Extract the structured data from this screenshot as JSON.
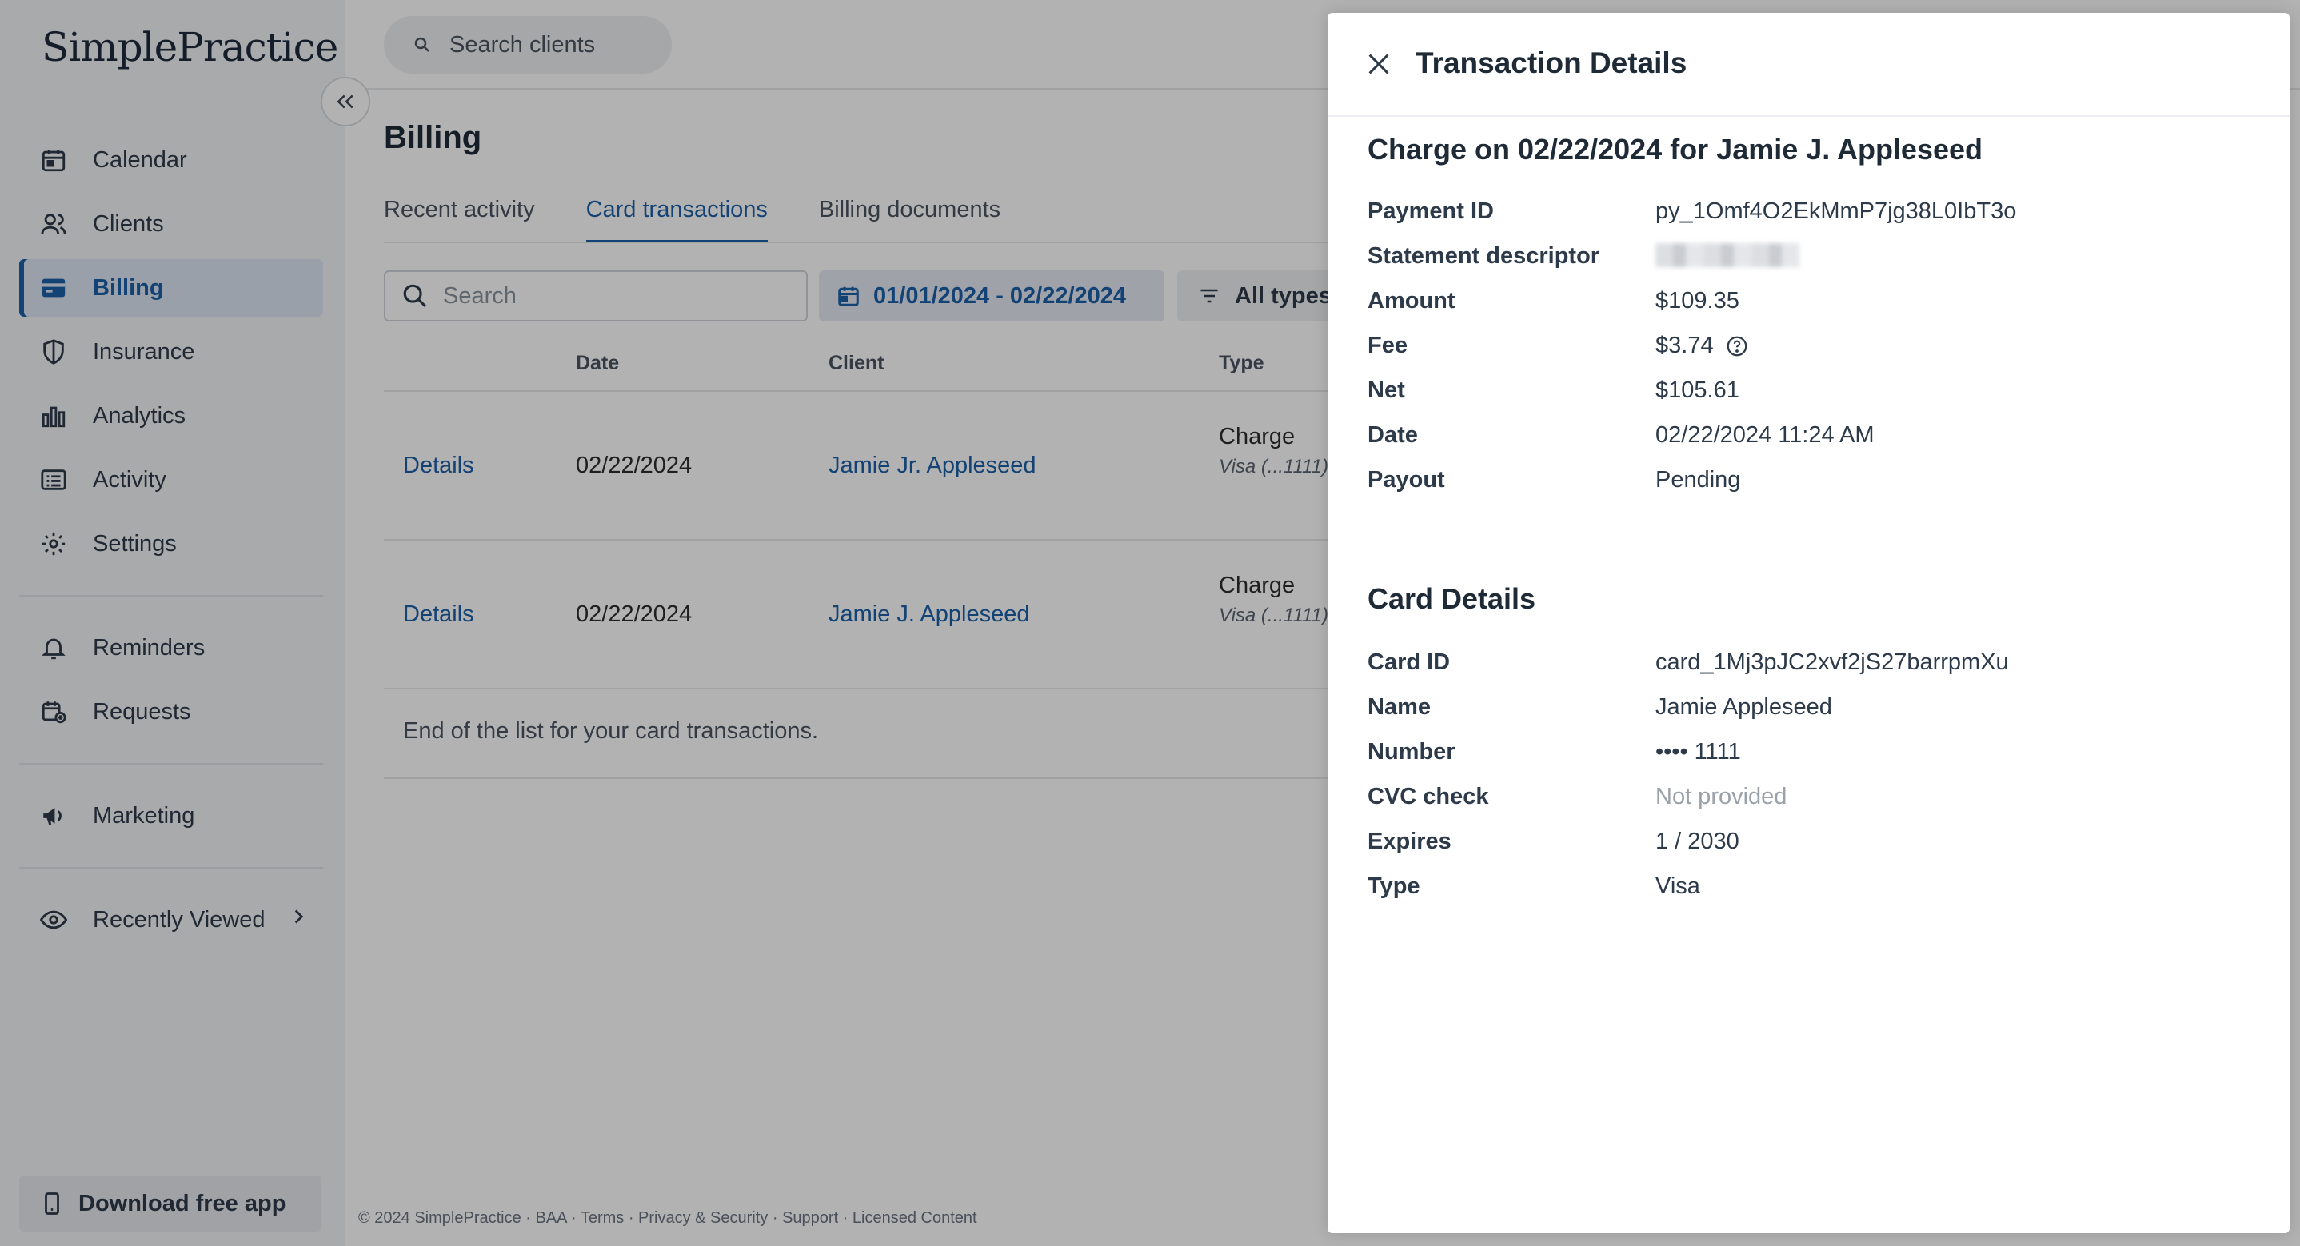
{
  "app": {
    "logo": "SimplePractice"
  },
  "sidebar": {
    "items": [
      {
        "label": "Calendar"
      },
      {
        "label": "Clients"
      },
      {
        "label": "Billing"
      },
      {
        "label": "Insurance"
      },
      {
        "label": "Analytics"
      },
      {
        "label": "Activity"
      },
      {
        "label": "Settings"
      },
      {
        "label": "Reminders"
      },
      {
        "label": "Requests"
      },
      {
        "label": "Marketing"
      },
      {
        "label": "Recently Viewed"
      }
    ],
    "active": "Billing",
    "download_label": "Download free app"
  },
  "topbar": {
    "search_placeholder": "Search clients"
  },
  "billing": {
    "title": "Billing",
    "tabs": [
      {
        "label": "Recent activity"
      },
      {
        "label": "Card transactions"
      },
      {
        "label": "Billing documents"
      }
    ],
    "active_tab": "Card transactions",
    "search_placeholder": "Search",
    "date_range": "01/01/2024 - 02/22/2024",
    "type_filter": "All types",
    "columns": [
      "Date",
      "Client",
      "Type"
    ],
    "rows": [
      {
        "details": "Details",
        "date": "02/22/2024",
        "client": "Jamie Jr. Appleseed",
        "type": "Charge",
        "card": "Visa (...1111)"
      },
      {
        "details": "Details",
        "date": "02/22/2024",
        "client": "Jamie J. Appleseed",
        "type": "Charge",
        "card": "Visa (...1111)"
      }
    ],
    "end_note": "End of the list for your card transactions."
  },
  "footer": {
    "text": "© 2024 SimplePractice · BAA · Terms · Privacy & Security · Support · Licensed Content"
  },
  "drawer": {
    "title": "Transaction Details",
    "charge_heading": "Charge on 02/22/2024 for Jamie J. Appleseed",
    "payment": {
      "payment_id_label": "Payment ID",
      "payment_id": "py_1Omf4O2EkMmP7jg38L0IbT3o",
      "statement_descriptor_label": "Statement descriptor",
      "amount_label": "Amount",
      "amount": "$109.35",
      "fee_label": "Fee",
      "fee": "$3.74",
      "net_label": "Net",
      "net": "$105.61",
      "date_label": "Date",
      "date": "02/22/2024 11:24 AM",
      "payout_label": "Payout",
      "payout": "Pending"
    },
    "card_heading": "Card Details",
    "card": {
      "card_id_label": "Card ID",
      "card_id": "card_1Mj3pJC2xvf2jS27barrpmXu",
      "name_label": "Name",
      "name": "Jamie Appleseed",
      "number_label": "Number",
      "number": "•••• 1111",
      "cvc_label": "CVC check",
      "cvc": "Not provided",
      "expires_label": "Expires",
      "expires": "1 / 2030",
      "type_label": "Type",
      "type": "Visa"
    }
  },
  "colors": {
    "accent": "#1c5fa8",
    "overlay": "rgba(0,0,0,0.3)"
  }
}
